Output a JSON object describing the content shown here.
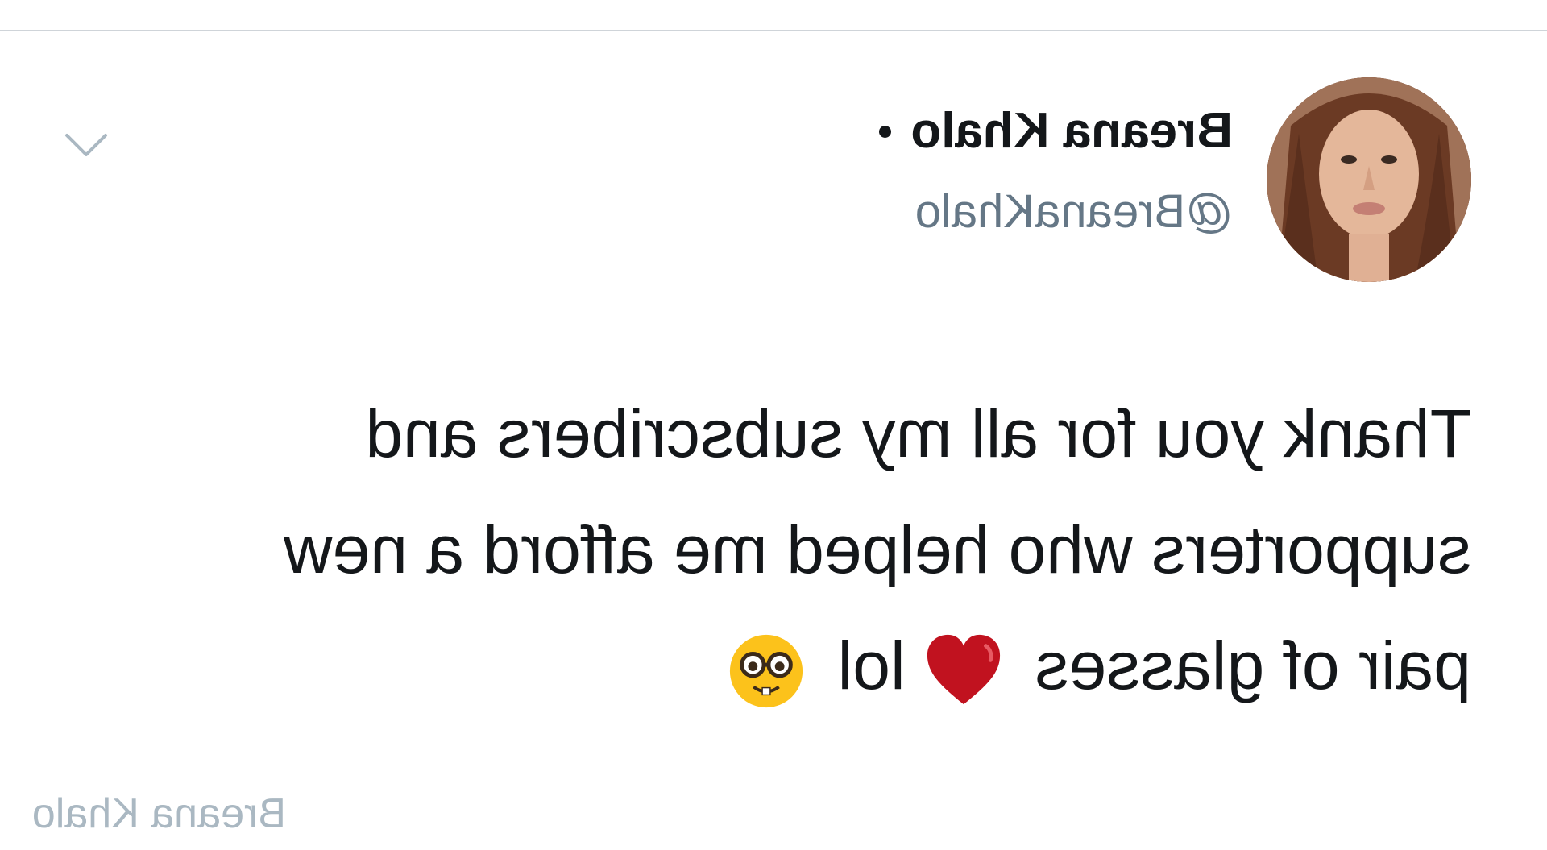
{
  "tweet": {
    "author": {
      "display_name": "Breana Khalo",
      "handle": "@BreanaKhalo",
      "avatar_icon": "profile-photo"
    },
    "menu_icon": "chevron-down-icon",
    "text_lines": [
      "Thank you for all my subscribers and",
      "supporters who helped me afford a new",
      "pair of glasses"
    ],
    "text_tail": "lol",
    "emojis": [
      "heart-icon",
      "nerd-face-icon"
    ],
    "footer_attribution": "Breana Khalo"
  },
  "colors": {
    "text_primary": "#14171a",
    "text_secondary": "#657786",
    "chevron": "#aab8c2",
    "footer": "#aab8c2",
    "divider": "#cfd4d9",
    "heart": "#c1121f",
    "emoji_yellow": "#fcc21b"
  },
  "layout_note_mirrored": "image is horizontally mirrored"
}
